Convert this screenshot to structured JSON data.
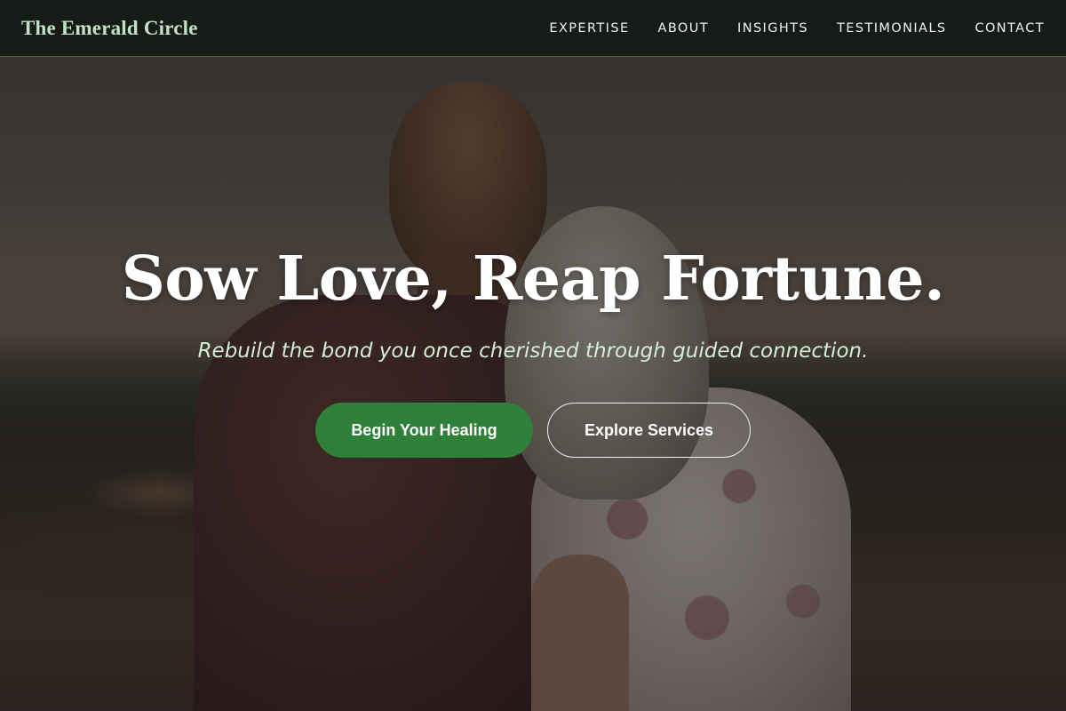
{
  "nav": {
    "brand": "The Emerald Circle",
    "links": [
      {
        "label": "EXPERTISE"
      },
      {
        "label": "ABOUT"
      },
      {
        "label": "INSIGHTS"
      },
      {
        "label": "TESTIMONIALS"
      },
      {
        "label": "CONTACT"
      }
    ]
  },
  "hero": {
    "title": "Sow Love, Reap Fortune.",
    "subtitle": "Rebuild the bond you once cherished through guided connection.",
    "primary_button": "Begin Your Healing",
    "secondary_button": "Explore Services"
  },
  "colors": {
    "nav_background": "#161b17",
    "brand_text": "#bfe3c4",
    "primary_button": "#2f8038",
    "subtitle_text": "#d4ecd2"
  }
}
